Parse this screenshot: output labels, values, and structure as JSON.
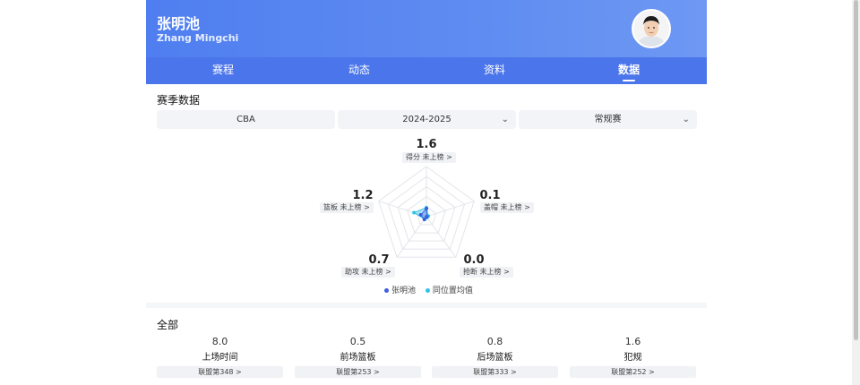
{
  "player": {
    "name": "张明池",
    "name_en": "Zhang Mingchi"
  },
  "tabs": [
    "赛程",
    "动态",
    "资料",
    "数据"
  ],
  "active_tab": 3,
  "season_section": {
    "title": "赛季数据",
    "league": "CBA",
    "season": "2024-2025",
    "stage": "常规赛"
  },
  "radar": {
    "stats": [
      {
        "label": "得分 未上榜 >",
        "value": "1.6",
        "player": 1.6,
        "avg": 1.8
      },
      {
        "label": "盖帽 未上榜 >",
        "value": "0.1",
        "player": 0.1,
        "avg": 0.4
      },
      {
        "label": "抢断 未上榜 >",
        "value": "0.0",
        "player": 0.0,
        "avg": 0.2
      },
      {
        "label": "助攻 未上榜 >",
        "value": "0.7",
        "player": 0.7,
        "avg": 0.6
      },
      {
        "label": "篮板 未上榜 >",
        "value": "1.2",
        "player": 1.2,
        "avg": 2.6
      }
    ],
    "max": 10,
    "legend_player": "张明池",
    "legend_avg": "同位置均值",
    "color_player": "#3b5fe0",
    "color_avg": "#2ec4e8"
  },
  "all_section": {
    "title": "全部",
    "metrics": [
      {
        "value": "8.0",
        "label": "上场时间",
        "rank": "联盟第348 >"
      },
      {
        "value": "0.5",
        "label": "前场篮板",
        "rank": "联盟第253 >"
      },
      {
        "value": "0.8",
        "label": "后场篮板",
        "rank": "联盟第333 >"
      },
      {
        "value": "1.6",
        "label": "犯规",
        "rank": "联盟第252 >"
      }
    ]
  }
}
